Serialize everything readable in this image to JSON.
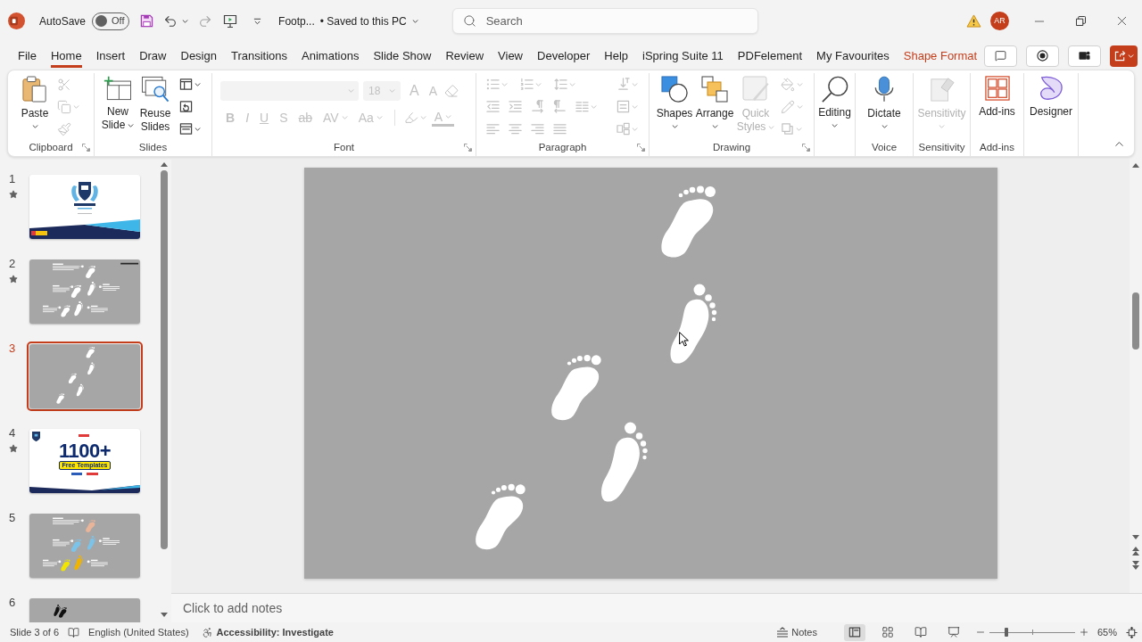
{
  "title_bar": {
    "autosave_label": "AutoSave",
    "autosave": {
      "on": false,
      "label": "Off"
    },
    "document_name": "Footp...",
    "save_status": "• Saved to this PC",
    "search": {
      "placeholder": "Search"
    },
    "avatar_initials": "AR"
  },
  "ribbon_tabs": [
    {
      "label": "File",
      "selected": false,
      "contextual": false
    },
    {
      "label": "Home",
      "selected": true,
      "contextual": false
    },
    {
      "label": "Insert",
      "selected": false,
      "contextual": false
    },
    {
      "label": "Draw",
      "selected": false,
      "contextual": false
    },
    {
      "label": "Design",
      "selected": false,
      "contextual": false
    },
    {
      "label": "Transitions",
      "selected": false,
      "contextual": false
    },
    {
      "label": "Animations",
      "selected": false,
      "contextual": false
    },
    {
      "label": "Slide Show",
      "selected": false,
      "contextual": false
    },
    {
      "label": "Review",
      "selected": false,
      "contextual": false
    },
    {
      "label": "View",
      "selected": false,
      "contextual": false
    },
    {
      "label": "Developer",
      "selected": false,
      "contextual": false
    },
    {
      "label": "Help",
      "selected": false,
      "contextual": false
    },
    {
      "label": "iSpring Suite 11",
      "selected": false,
      "contextual": false
    },
    {
      "label": "PDFelement",
      "selected": false,
      "contextual": false
    },
    {
      "label": "My Favourites",
      "selected": false,
      "contextual": false
    },
    {
      "label": "Shape Format",
      "selected": false,
      "contextual": true
    }
  ],
  "ribbon": {
    "groups": [
      {
        "kind": "clipboard",
        "label": "Clipboard",
        "launcher": true,
        "large": [
          {
            "label": "Paste",
            "disabled": false,
            "dropdown": true
          }
        ],
        "tools": [
          {
            "disabled": true,
            "dropdown": false
          },
          {
            "disabled": true,
            "dropdown": true
          },
          {
            "disabled": true,
            "dropdown": false
          }
        ]
      },
      {
        "kind": "slides",
        "label": "Slides",
        "launcher": false,
        "large": [
          {
            "label": "New Slide",
            "disabled": false,
            "dropdown": true
          },
          {
            "label": "Reuse Slides",
            "disabled": false,
            "dropdown": false
          }
        ],
        "tools": [
          {
            "disabled": false,
            "dropdown": true
          },
          {
            "disabled": false,
            "dropdown": false
          },
          {
            "disabled": false,
            "dropdown": true
          }
        ]
      },
      {
        "kind": "font",
        "label": "Font",
        "launcher": true,
        "font_name": {
          "disabled": true
        },
        "font_size": {
          "value": "18",
          "disabled": true
        },
        "tools": [
          {
            "label": "A",
            "disabled": true,
            "dropdown": false
          },
          {
            "label": "A",
            "disabled": true,
            "dropdown": false
          },
          {
            "disabled": true,
            "dropdown": false
          },
          {
            "label": "B",
            "disabled": true,
            "dropdown": false
          },
          {
            "label": "I",
            "disabled": true,
            "dropdown": false
          },
          {
            "label": "U",
            "disabled": true,
            "dropdown": false
          },
          {
            "label": "S",
            "disabled": true,
            "dropdown": false
          },
          {
            "label": "ab",
            "disabled": true,
            "dropdown": false
          },
          {
            "label": "AV",
            "disabled": true,
            "dropdown": true
          },
          {
            "label": "Aa",
            "disabled": true,
            "dropdown": true
          },
          {
            "disabled": true,
            "dropdown": true
          },
          {
            "label": "A",
            "disabled": true,
            "dropdown": true
          }
        ]
      },
      {
        "kind": "paragraph",
        "label": "Paragraph",
        "launcher": true,
        "tools": [
          {
            "disabled": true,
            "dropdown": true
          },
          {
            "disabled": true,
            "dropdown": true
          },
          {
            "disabled": true,
            "dropdown": true
          },
          {
            "disabled": true,
            "dropdown": true
          },
          {
            "disabled": true,
            "dropdown": false
          },
          {
            "disabled": true,
            "dropdown": false
          },
          {
            "disabled": true,
            "dropdown": false
          },
          {
            "disabled": true,
            "dropdown": false
          },
          {
            "disabled": true,
            "dropdown": true
          },
          {
            "disabled": true,
            "dropdown": true
          },
          {
            "disabled": true,
            "dropdown": false
          },
          {
            "disabled": true,
            "dropdown": false
          },
          {
            "disabled": true,
            "dropdown": false
          },
          {
            "disabled": true,
            "dropdown": false
          },
          {
            "disabled": true,
            "dropdown": true
          }
        ]
      },
      {
        "kind": "drawing",
        "label": "Drawing",
        "launcher": true,
        "large": [
          {
            "label": "Shapes",
            "disabled": false,
            "dropdown": true
          },
          {
            "label": "Arrange",
            "disabled": false,
            "dropdown": true
          },
          {
            "label": "Quick Styles",
            "disabled": true,
            "dropdown": true
          }
        ],
        "tools": [
          {
            "disabled": true,
            "dropdown": true
          },
          {
            "disabled": true,
            "dropdown": true
          },
          {
            "disabled": true,
            "dropdown": true
          }
        ]
      },
      {
        "kind": "single",
        "launcher": false,
        "large": [
          {
            "label": "Editing",
            "disabled": false,
            "dropdown": true
          }
        ]
      },
      {
        "kind": "single",
        "label": "Voice",
        "launcher": false,
        "large": [
          {
            "label": "Dictate",
            "disabled": false,
            "dropdown": true
          }
        ]
      },
      {
        "kind": "single",
        "label": "Sensitivity",
        "launcher": false,
        "large": [
          {
            "label": "Sensitivity",
            "disabled": true,
            "dropdown": true
          }
        ]
      },
      {
        "kind": "single",
        "label": "Add-ins",
        "launcher": false,
        "large": [
          {
            "label": "Add-ins",
            "disabled": false,
            "dropdown": false
          }
        ]
      },
      {
        "kind": "single",
        "launcher": false,
        "large": [
          {
            "label": "Designer",
            "disabled": false,
            "dropdown": false
          }
        ]
      }
    ]
  },
  "slides": [
    {
      "number": "1",
      "kind": "title",
      "selected": false,
      "animated": true
    },
    {
      "number": "2",
      "kind": "footprints-labeled",
      "selected": false,
      "animated": true
    },
    {
      "number": "3",
      "kind": "footprints",
      "selected": true,
      "animated": false
    },
    {
      "number": "4",
      "kind": "promo",
      "selected": false,
      "animated": true,
      "headline": "1100+",
      "tagline": "Free Templates"
    },
    {
      "number": "5",
      "kind": "footprints-colored",
      "selected": false,
      "animated": false
    },
    {
      "number": "6",
      "kind": "dark-footprint",
      "selected": false,
      "animated": false
    }
  ],
  "notes": {
    "placeholder": "Click to add notes"
  },
  "status_bar": {
    "slide_position": "Slide 3 of 6",
    "language": "English (United States)",
    "accessibility": "Accessibility: Investigate",
    "notes_button": "Notes",
    "views": [
      {
        "selected": true
      },
      {
        "selected": false
      },
      {
        "selected": false
      },
      {
        "selected": false
      }
    ],
    "zoom": {
      "level": 0.2,
      "label": "65%"
    }
  }
}
